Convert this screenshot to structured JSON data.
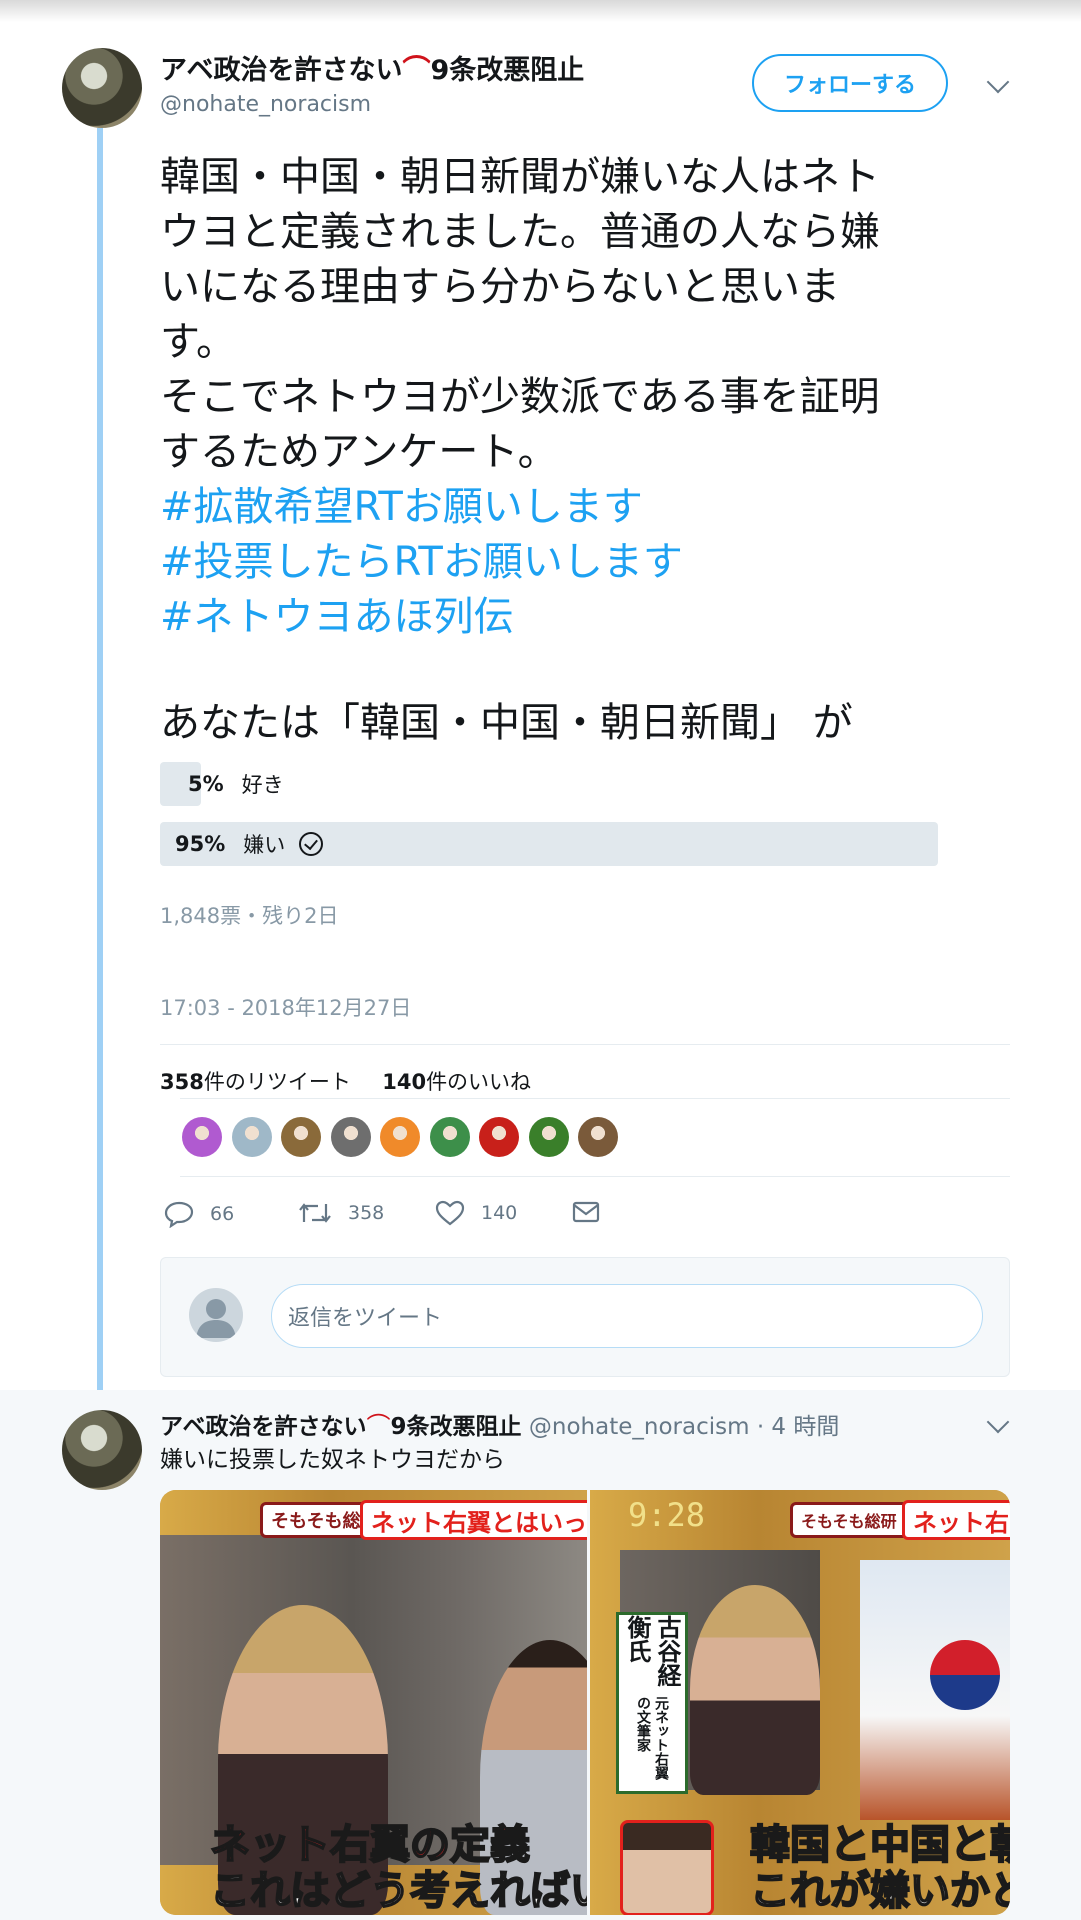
{
  "tweet": {
    "author_name": "アベ政治を許さない",
    "author_name_suffix": "9条改悪阻止",
    "emoji": "shrimp-emoji",
    "handle": "@nohate_noracism",
    "follow_label": "フォローする",
    "text_lines": [
      "韓国・中国・朝日新聞が嫌いな人はネト",
      "ウヨと定義されました。普通の人なら嫌",
      "いになる理由すら分からないと思いま",
      "す。",
      "そこでネトウヨが少数派である事を証明",
      "するためアンケート。"
    ],
    "hashtags": [
      "#拡散希望RTお願いします",
      "#投票したらRTお願いします",
      "#ネトウヨあほ列伝"
    ],
    "poll": {
      "question": "あなたは「韓国・中国・朝日新聞」 が",
      "options": [
        {
          "percent_label": "5%",
          "label": "好き",
          "value": 5
        },
        {
          "percent_label": "95%",
          "label": "嫌い",
          "value": 95,
          "selected": true
        }
      ],
      "summary": "1,848票・残り2日"
    },
    "timestamp": "17:03 - 2018年12月27日",
    "retweet_count": "358",
    "retweet_label": "件のリツイート",
    "like_count": "140",
    "like_label": "件のいいね",
    "liker_colors": [
      "#b05ad0",
      "#9fb8c8",
      "#8a6a3a",
      "#6e6e6e",
      "#f08a2a",
      "#3d8f4a",
      "#c8201a",
      "#3a7f2a",
      "#7a5a3a"
    ],
    "actions": {
      "reply": "66",
      "retweet": "358",
      "like": "140"
    },
    "reply_placeholder": "返信をツイート"
  },
  "reply": {
    "author_name": "アベ政治を許さない",
    "author_name_suffix": "9条改悪阻止",
    "handle": "@nohate_noracism",
    "time": "· 4 時間",
    "text": "嫌いに投票した奴ネトウヨだから",
    "media_left": {
      "banner_left": "そもそも総研",
      "banner_right": "ネット右翼とはいった",
      "caption1": "ネット右翼の定義",
      "caption2": "これはどう考えればい"
    },
    "media_right": {
      "clock": "9:28",
      "banner_left": "そもそも総研",
      "banner_right": "ネット右",
      "vertical_caption": "古谷経衡氏",
      "vertical_sub": "元ネット右翼の文筆家",
      "caption1": "韓国と中国と朝",
      "caption2": "これが嫌いかど"
    }
  }
}
